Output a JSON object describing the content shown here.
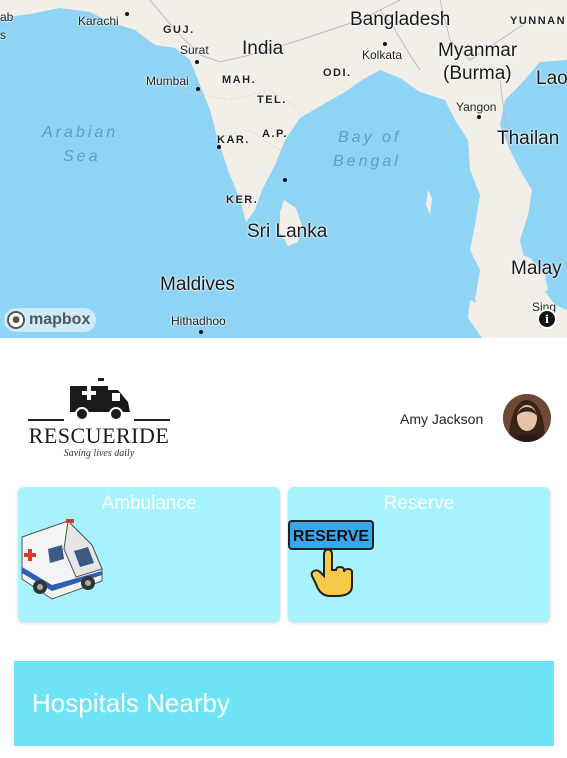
{
  "map": {
    "countries": [
      "India",
      "Bangladesh",
      "Myanmar",
      "(Burma)",
      "Sri Lanka",
      "Maldives",
      "Thailan",
      "Malay",
      "Lao"
    ],
    "states": [
      "GUJ.",
      "MAH.",
      "TEL.",
      "ODI.",
      "KAR.",
      "A.P.",
      "KER.",
      "YUNNAN"
    ],
    "cities": [
      "Karachi",
      "Surat",
      "Mumbai",
      "Kolkata",
      "Yangon",
      "Hithadhoo",
      "Sing",
      "ab",
      "s"
    ],
    "seas": [
      "Arabian",
      "Sea",
      "Bay of",
      "Bengal"
    ],
    "attribution": "mapbox",
    "info_glyph": "i",
    "water_color": "#8fd3f5",
    "land_color": "#f2efe9"
  },
  "header": {
    "brand_name": "RESCUERIDE",
    "brand_tagline": "Saving lives daily",
    "user_name": "Amy Jackson"
  },
  "cards": {
    "ambulance": {
      "title": "Ambulance",
      "icon": "ambulance-icon"
    },
    "reserve": {
      "title": "Reserve",
      "icon": "reserve-hand-icon",
      "sign_text": "RESERVE"
    }
  },
  "hospitals": {
    "title": "Hospitals Nearby"
  },
  "colors": {
    "card_bg": "#a6f2fd",
    "hospitals_bg": "#6de3f5",
    "text_on_accent": "#ffffff"
  }
}
